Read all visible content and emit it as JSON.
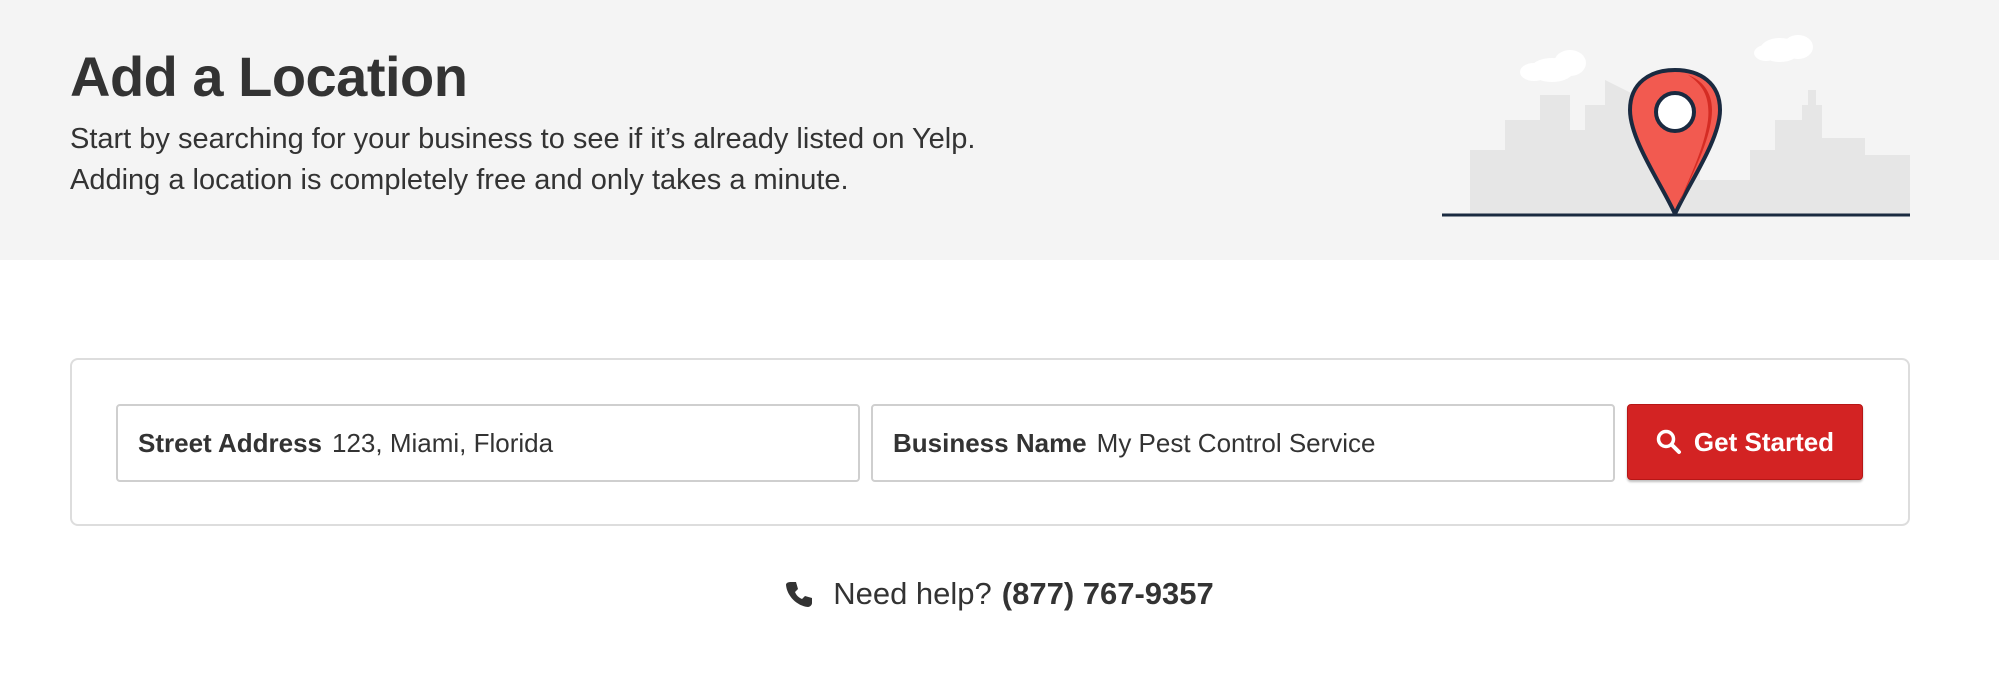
{
  "hero": {
    "title": "Add a Location",
    "line1": "Start by searching for your business to see if it’s already listed on Yelp.",
    "line2": "Adding a location is completely free and only takes a minute.",
    "illustration_icon": "map-pin-city-icon"
  },
  "search": {
    "address": {
      "label": "Street Address",
      "value": "123, Miami, Florida"
    },
    "business": {
      "label": "Business Name",
      "value": "My Pest Control Service"
    },
    "button": {
      "label": "Get Started",
      "icon": "search-icon"
    }
  },
  "help": {
    "icon": "phone-icon",
    "text": "Need help?",
    "number": "(877) 767-9357"
  },
  "colors": {
    "hero_bg": "#f4f4f4",
    "accent": "#d32323",
    "pin": "#f25a50",
    "pin_shade": "#d42c24",
    "outline": "#1a2a40",
    "skyline": "#e6e6e6",
    "text": "#333333"
  }
}
